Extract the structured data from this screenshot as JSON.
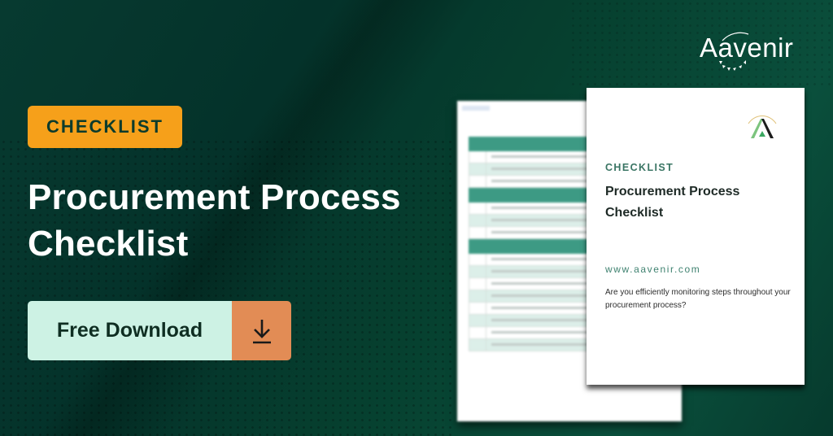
{
  "brand": {
    "name": "Aavenir",
    "colors": {
      "background": "#06392c",
      "badge": "#f6a01a",
      "badge_text": "#0c3b2c",
      "cta_label_bg": "#cdf2e4",
      "cta_icon_bg": "#e28c55",
      "accent_green": "#3d9a84"
    }
  },
  "hero": {
    "badge": "CHECKLIST",
    "title_line1": "Procurement Process",
    "title_line2": "Checklist",
    "cta_label": "Free Download",
    "cta_icon": "download-icon"
  },
  "cover": {
    "kicker": "CHECKLIST",
    "title_line1": "Procurement Process",
    "title_line2": "Checklist",
    "url": "www.aavenir.com",
    "description": "Are you efficiently monitoring steps throughout your procurement process?",
    "logo_icon": "aavenir-a-mark-icon"
  },
  "back_page": {
    "sections": [
      {
        "rows": 3
      },
      {
        "rows": 3
      },
      {
        "rows": 8
      }
    ]
  }
}
